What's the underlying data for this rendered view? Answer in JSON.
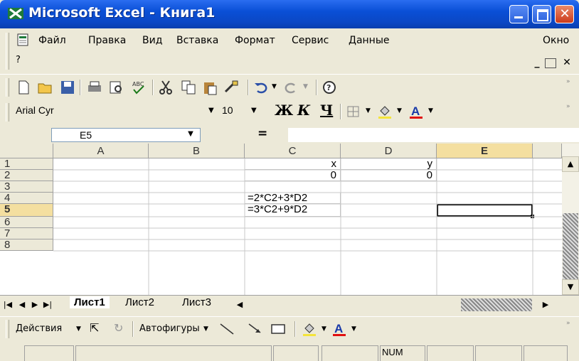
{
  "window": {
    "title": "Microsoft Excel - Книга1"
  },
  "menu": [
    "Файл",
    "Правка",
    "Вид",
    "Вставка",
    "Формат",
    "Сервис",
    "Данные",
    "Окно",
    "?"
  ],
  "format_toolbar": {
    "font_name": "Arial Cyr",
    "font_size": "10",
    "bold": "Ж",
    "italic": "К",
    "underline": "Ч"
  },
  "formula_bar": {
    "name_box": "E5",
    "equals": "=",
    "formula": ""
  },
  "columns": [
    "A",
    "B",
    "C",
    "D",
    "E"
  ],
  "rows": [
    "1",
    "2",
    "3",
    "4",
    "5",
    "6",
    "7",
    "8"
  ],
  "cells": {
    "C1": "x",
    "D1": "y",
    "C2": "0",
    "D2": "0",
    "C4": "=2*C2+3*D2",
    "C5": "=3*C2+9*D2"
  },
  "active_cell": "E5",
  "sheet_tabs": [
    "Лист1",
    "Лист2",
    "Лист3"
  ],
  "active_sheet": "Лист1",
  "drawing_toolbar": {
    "actions": "Действия",
    "autoshapes": "Автофигуры"
  },
  "status": {
    "num": "NUM"
  },
  "colors": {
    "titlebar": "#0a4fd6",
    "chrome": "#ece9d8",
    "close": "#cc3b1b"
  }
}
